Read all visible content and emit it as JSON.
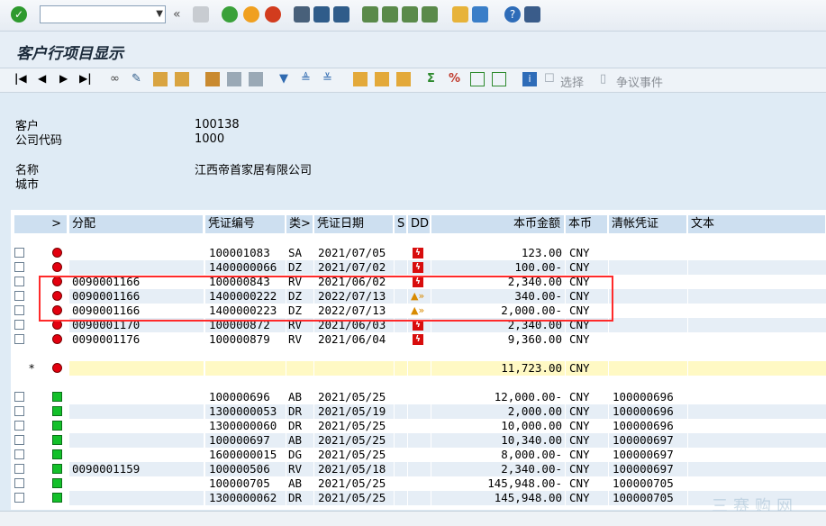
{
  "window": {
    "title": "客户行项目显示"
  },
  "toolbar": {
    "command_field_value": ""
  },
  "app_toolbar": {
    "select_label": "选择",
    "dispute_label": "争议事件"
  },
  "header": {
    "customer_label": "客户",
    "customer_value": "100138",
    "company_label": "公司代码",
    "company_value": "1000",
    "name_label": "名称",
    "name_value": "江西帝首家居有限公司",
    "city_label": "城市",
    "city_value": ""
  },
  "columns": {
    "arrow": ">",
    "assignment": "分配",
    "doc_no": "凭证编号",
    "type": "类>",
    "doc_date": "凭证日期",
    "s": "S",
    "dd": "DD",
    "amount": "本币金额",
    "currency": "本币",
    "clearing": "清帐凭证",
    "text": "文本"
  },
  "rows_open": [
    {
      "assign": "",
      "doc": "100001083",
      "type": "SA",
      "date": "2021/07/05",
      "amount": "123.00",
      "cur": "CNY",
      "clear": "",
      "dd": "red"
    },
    {
      "assign": "",
      "doc": "1400000066",
      "type": "DZ",
      "date": "2021/07/02",
      "amount": "100.00-",
      "cur": "CNY",
      "clear": "",
      "dd": "red"
    },
    {
      "assign": "0090001166",
      "doc": "100000843",
      "type": "RV",
      "date": "2021/06/02",
      "amount": "2,340.00",
      "cur": "CNY",
      "clear": "",
      "dd": "red"
    },
    {
      "assign": "0090001166",
      "doc": "1400000222",
      "type": "DZ",
      "date": "2022/07/13",
      "amount": "340.00-",
      "cur": "CNY",
      "clear": "",
      "dd": "warn"
    },
    {
      "assign": "0090001166",
      "doc": "1400000223",
      "type": "DZ",
      "date": "2022/07/13",
      "amount": "2,000.00-",
      "cur": "CNY",
      "clear": "",
      "dd": "warn"
    },
    {
      "assign": "0090001170",
      "doc": "100000872",
      "type": "RV",
      "date": "2021/06/03",
      "amount": "2,340.00",
      "cur": "CNY",
      "clear": "",
      "dd": "red"
    },
    {
      "assign": "0090001176",
      "doc": "100000879",
      "type": "RV",
      "date": "2021/06/04",
      "amount": "9,360.00",
      "cur": "CNY",
      "clear": "",
      "dd": "red"
    }
  ],
  "subtotal": {
    "star": "*",
    "amount": "11,723.00",
    "cur": "CNY"
  },
  "rows_cleared": [
    {
      "assign": "",
      "doc": "100000696",
      "type": "AB",
      "date": "2021/05/25",
      "amount": "12,000.00-",
      "cur": "CNY",
      "clear": "100000696"
    },
    {
      "assign": "",
      "doc": "1300000053",
      "type": "DR",
      "date": "2021/05/19",
      "amount": "2,000.00",
      "cur": "CNY",
      "clear": "100000696"
    },
    {
      "assign": "",
      "doc": "1300000060",
      "type": "DR",
      "date": "2021/05/25",
      "amount": "10,000.00",
      "cur": "CNY",
      "clear": "100000696"
    },
    {
      "assign": "",
      "doc": "100000697",
      "type": "AB",
      "date": "2021/05/25",
      "amount": "10,340.00",
      "cur": "CNY",
      "clear": "100000697"
    },
    {
      "assign": "",
      "doc": "1600000015",
      "type": "DG",
      "date": "2021/05/25",
      "amount": "8,000.00-",
      "cur": "CNY",
      "clear": "100000697"
    },
    {
      "assign": "0090001159",
      "doc": "100000506",
      "type": "RV",
      "date": "2021/05/18",
      "amount": "2,340.00-",
      "cur": "CNY",
      "clear": "100000697"
    },
    {
      "assign": "",
      "doc": "100000705",
      "type": "AB",
      "date": "2021/05/25",
      "amount": "145,948.00-",
      "cur": "CNY",
      "clear": "100000705"
    },
    {
      "assign": "",
      "doc": "1300000062",
      "type": "DR",
      "date": "2021/05/25",
      "amount": "145,948.00",
      "cur": "CNY",
      "clear": "100000705"
    }
  ],
  "watermark": "三赛购网",
  "colors": {
    "accent": "#cddff0",
    "highlight": "#ff2a2a",
    "subtotal": "#fff9c4",
    "red_status": "#e3000f",
    "green_status": "#13c02a"
  }
}
